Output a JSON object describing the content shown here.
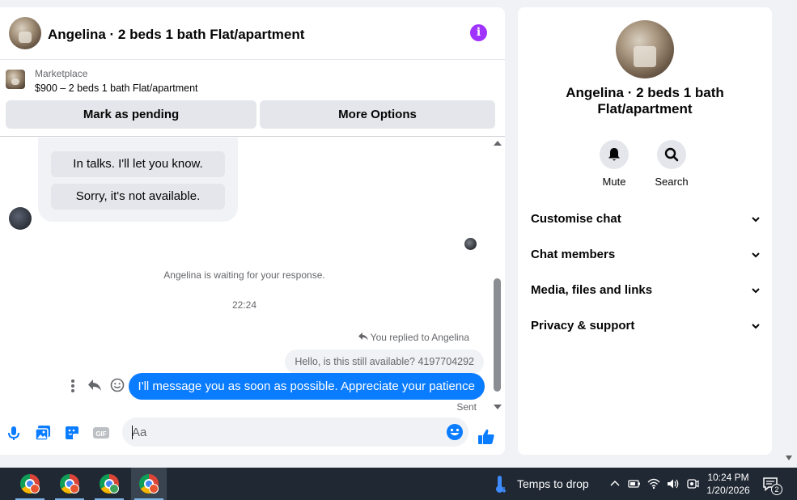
{
  "chat": {
    "header_title": "Angelina · 2 beds 1 bath Flat/apartment",
    "marketplace_label": "Marketplace",
    "listing_price": "$900 – 2 beds 1 bath Flat/apartment",
    "mark_pending_label": "Mark as pending",
    "more_options_label": "More Options",
    "quick_replies": [
      "In talks. I'll let you know.",
      "Sorry, it's not available."
    ],
    "waiting_text": "Angelina is waiting for your response.",
    "timestamp": "22:24",
    "replied_text": "You replied to Angelina",
    "quoted_message": "Hello, is this still available? 4197704292",
    "my_message": "I'll message you as soon as possible. Appreciate your patience",
    "sent_status": "Sent",
    "input_placeholder": "Aa",
    "accent_color": "#0a7cff",
    "info_icon_color": "#a033ff"
  },
  "info": {
    "title": "Angelina · 2 beds 1 bath Flat/apartment",
    "actions": [
      {
        "label": "Mute",
        "icon": "bell-icon"
      },
      {
        "label": "Search",
        "icon": "search-icon"
      }
    ],
    "sections": [
      {
        "label": "Customise chat"
      },
      {
        "label": "Chat members"
      },
      {
        "label": "Media, files and links"
      },
      {
        "label": "Privacy & support"
      }
    ]
  },
  "taskbar": {
    "apps": [
      {
        "name": "chrome",
        "badge_color": "#e8542f",
        "active": false
      },
      {
        "name": "chrome",
        "badge_color": "#e8542f",
        "active": false
      },
      {
        "name": "chrome",
        "badge_color": "#3fa35b",
        "active": false
      },
      {
        "name": "chrome",
        "badge_color": "#e8542f",
        "active": true
      }
    ],
    "weather_label": "Temps to drop",
    "time": "10:24 PM",
    "date": "1/20/2026",
    "notification_count": "2"
  }
}
